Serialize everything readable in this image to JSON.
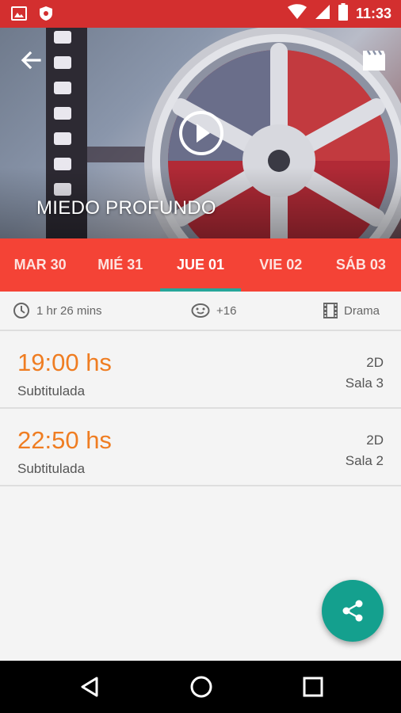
{
  "status_bar": {
    "time": "11:33",
    "icons": [
      "image-icon",
      "shield-icon",
      "wifi-icon",
      "signal-icon",
      "battery-icon"
    ]
  },
  "hero": {
    "title": "MIEDO PROFUNDO",
    "icons": [
      "back-arrow-icon",
      "clapperboard-icon",
      "play-icon"
    ]
  },
  "date_tabs": [
    {
      "label": "MAR 30",
      "active": false
    },
    {
      "label": "MIÉ 31",
      "active": false
    },
    {
      "label": "JUE 01",
      "active": true
    },
    {
      "label": "VIE 02",
      "active": false
    },
    {
      "label": "SÁB 03",
      "active": false
    }
  ],
  "info": {
    "duration": "1 hr 26 mins",
    "rating": "+16",
    "genre": "Drama"
  },
  "showtimes": [
    {
      "time": "19:00 hs",
      "language": "Subtitulada",
      "format": "2D",
      "room": "Sala 3"
    },
    {
      "time": "22:50 hs",
      "language": "Subtitulada",
      "format": "2D",
      "room": "Sala 2"
    }
  ],
  "colors": {
    "status_bar": "#d32f2f",
    "tabs_bg": "#f44336",
    "tab_indicator": "#26a69a",
    "time_orange": "#ef7d22",
    "fab": "#14a08e"
  }
}
